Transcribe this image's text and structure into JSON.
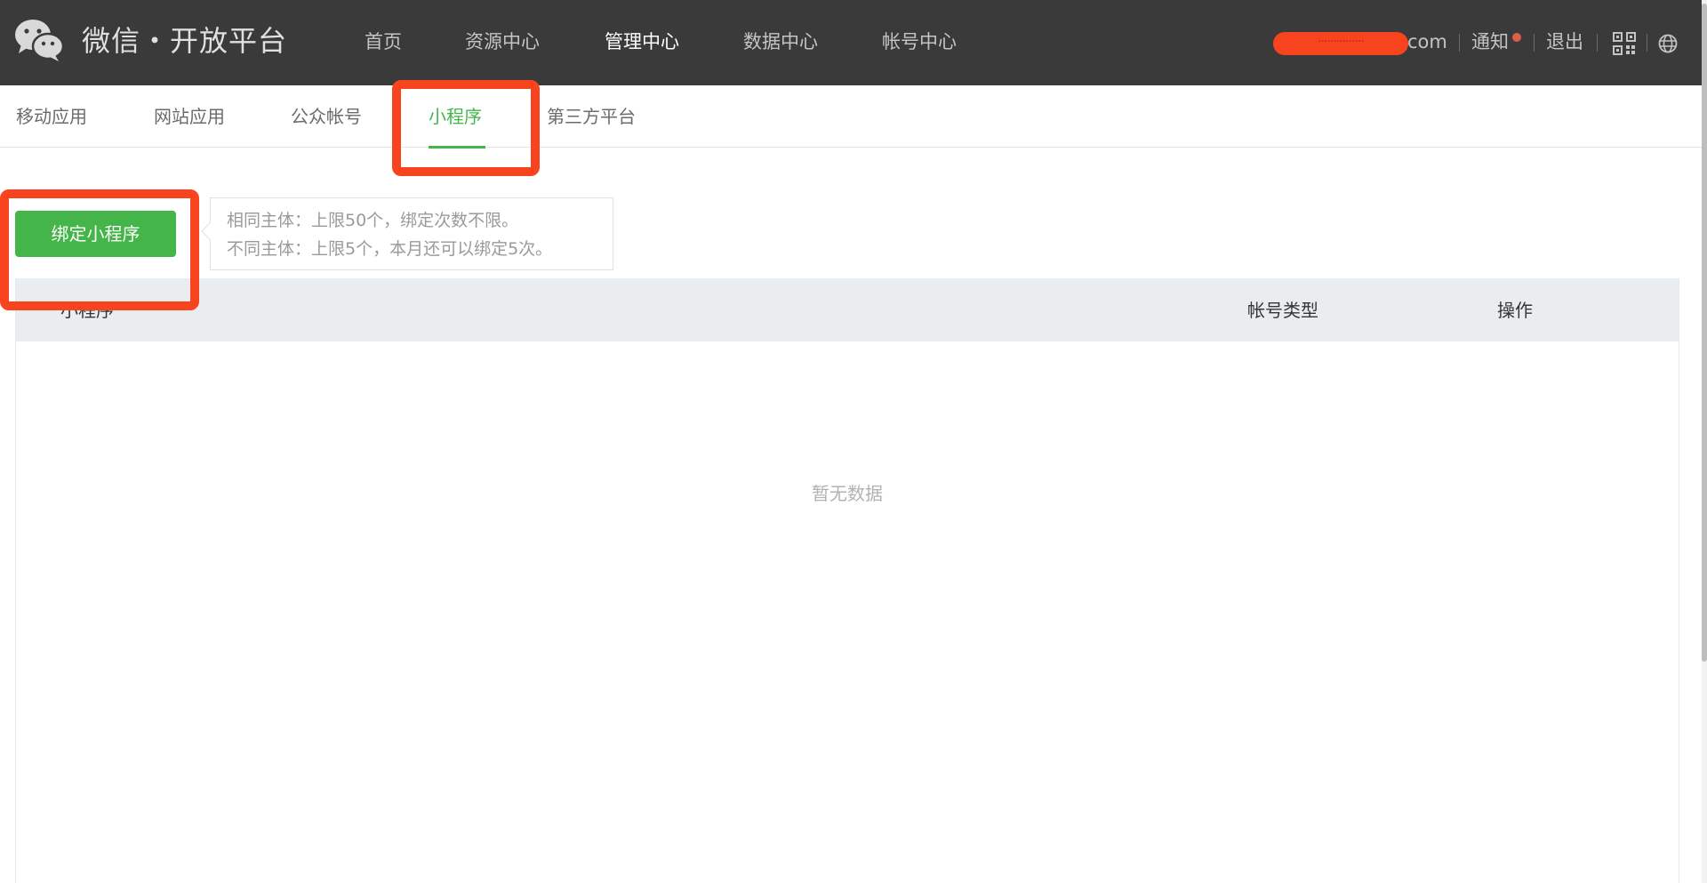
{
  "header": {
    "brand": "微信・开放平台",
    "logo_icon": "wechat-logo-icon",
    "nav": [
      {
        "label": "首页",
        "active": false
      },
      {
        "label": "资源中心",
        "active": false
      },
      {
        "label": "管理中心",
        "active": true
      },
      {
        "label": "数据中心",
        "active": false
      },
      {
        "label": "帐号中心",
        "active": false
      }
    ],
    "user": {
      "email_redacted": "···············",
      "email_suffix": "com",
      "notify_label": "通知",
      "logout_label": "退出",
      "qr_icon": "qrcode-icon",
      "lang_icon": "globe-icon"
    }
  },
  "subnav": {
    "tabs": [
      {
        "label": "移动应用",
        "active": false
      },
      {
        "label": "网站应用",
        "active": false
      },
      {
        "label": "公众帐号",
        "active": false
      },
      {
        "label": "小程序",
        "active": true
      },
      {
        "label": "第三方平台",
        "active": false
      }
    ]
  },
  "actions": {
    "bind_button_label": "绑定小程序",
    "tips": [
      "相同主体：上限50个，绑定次数不限。",
      "不同主体：上限5个，本月还可以绑定5次。"
    ]
  },
  "table": {
    "columns": [
      "小程序",
      "帐号类型",
      "操作"
    ],
    "empty_text": "暂无数据"
  },
  "colors": {
    "topbar_bg": "#3a3a3a",
    "accent_green": "#44b549",
    "highlight_red": "#f8431f"
  }
}
